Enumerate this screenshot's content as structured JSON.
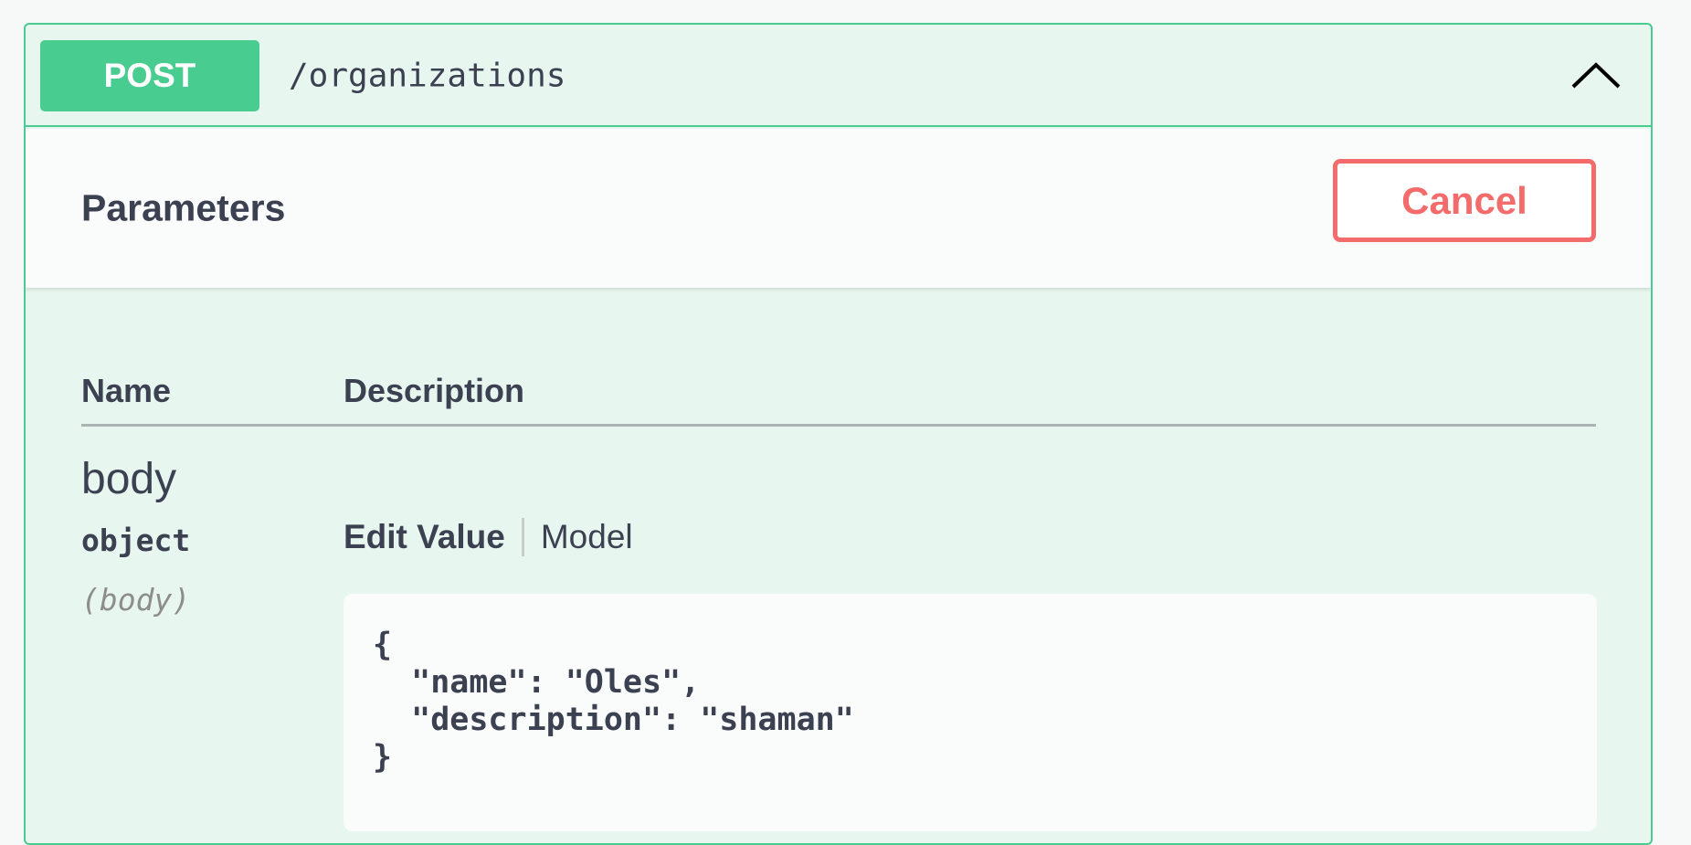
{
  "operation": {
    "method": "POST",
    "path": "/organizations",
    "collapse_icon": "chevron-up-icon",
    "color": "#49cc90"
  },
  "parameters": {
    "title": "Parameters",
    "cancel_label": "Cancel",
    "cancel_color": "#f36b6b",
    "columns": [
      "Name",
      "Description"
    ],
    "rows": [
      {
        "name": "body",
        "type": "object",
        "in": "(body)",
        "tabs": [
          "Edit Value",
          "Model"
        ],
        "value": "{\n  \"name\": \"Oles\",\n  \"description\": \"shaman\"\n}"
      }
    ]
  }
}
